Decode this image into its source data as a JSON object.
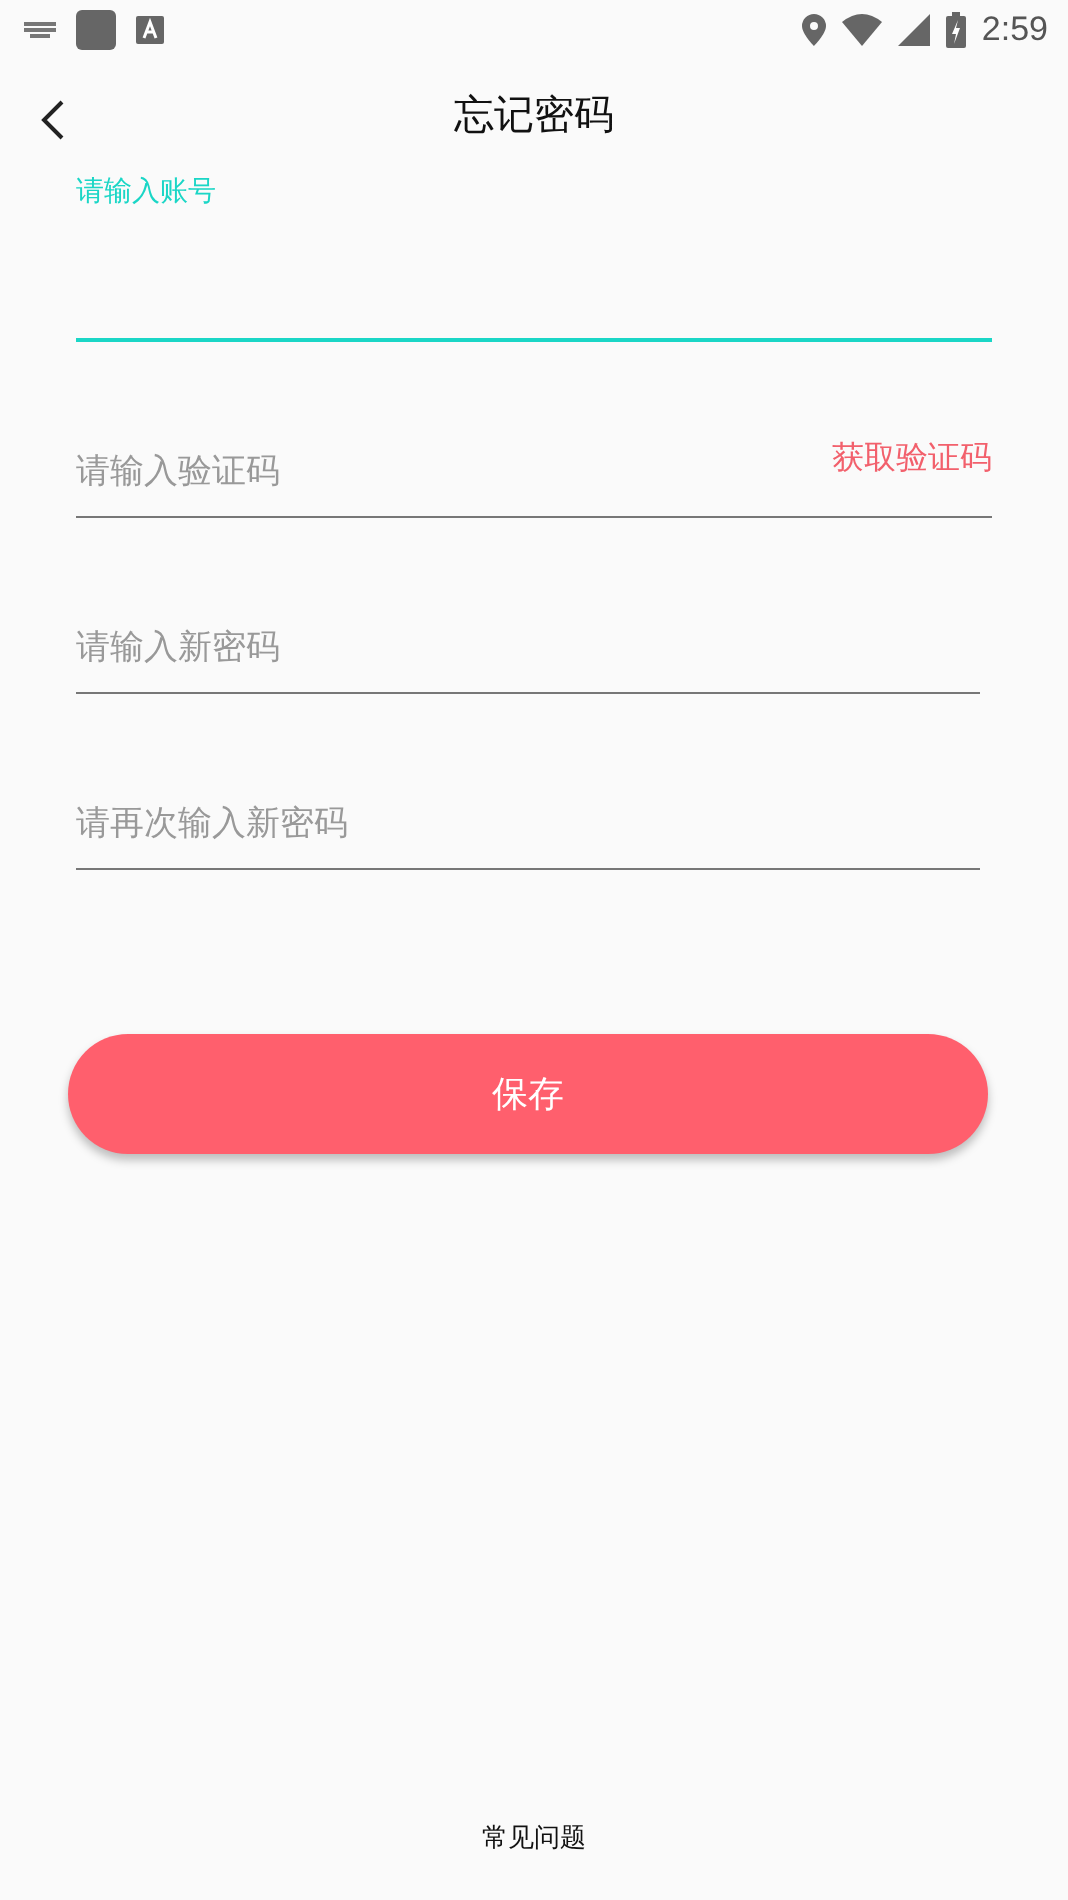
{
  "status_bar": {
    "time": "2:59"
  },
  "header": {
    "title": "忘记密码"
  },
  "fields": [
    {
      "placeholder": "请输入账号",
      "focused": true
    },
    {
      "placeholder": "请输入验证码",
      "focused": false,
      "action": "获取验证码"
    },
    {
      "placeholder": "请输入新密码",
      "focused": false
    },
    {
      "placeholder": "请再次输入新密码",
      "focused": false
    }
  ],
  "save_button": "保存",
  "footer_link": "常见问题"
}
